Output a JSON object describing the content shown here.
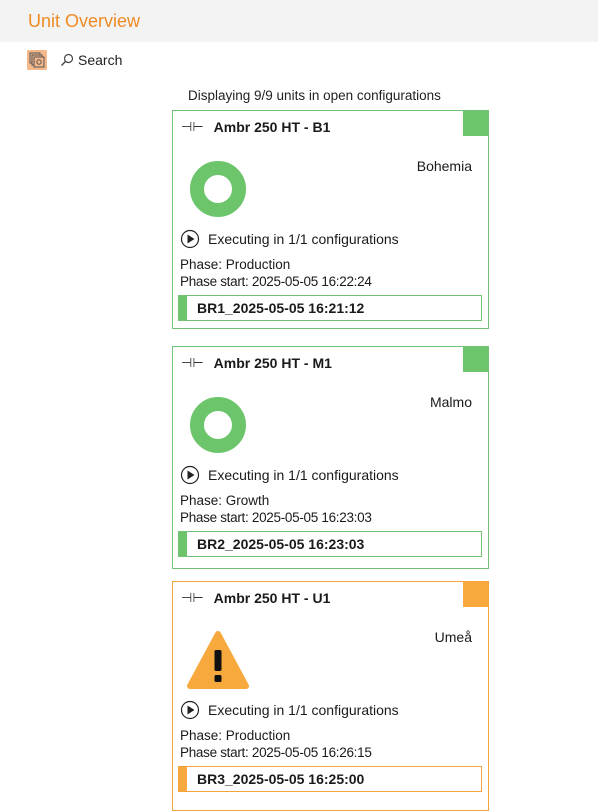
{
  "header": {
    "title": "Unit Overview"
  },
  "toolbar": {
    "search_label": "Search"
  },
  "summary": {
    "text": "Displaying 9/9 units in open configurations"
  },
  "colors": {
    "accent": "#f08a24",
    "ok": "#6cc56b",
    "warning": "#f7a93d"
  },
  "units": [
    {
      "name": "Ambr 250 HT - B1",
      "location": "Bohemia",
      "status": "ok",
      "status_icon": "ring-icon",
      "execution": "Executing in 1/1 configurations",
      "phase": "Phase: Production",
      "phase_start": "Phase start: 2025-05-05 16:22:24",
      "run": "BR1_2025-05-05 16:21:12"
    },
    {
      "name": "Ambr 250 HT - M1",
      "location": "Malmo",
      "status": "ok",
      "status_icon": "ring-icon",
      "execution": "Executing in 1/1 configurations",
      "phase": "Phase: Growth",
      "phase_start": "Phase start: 2025-05-05 16:23:03",
      "run": "BR2_2025-05-05 16:23:03"
    },
    {
      "name": "Ambr 250 HT - U1",
      "location": "Umeå",
      "status": "warning",
      "status_icon": "warning-icon",
      "execution": "Executing in 1/1 configurations",
      "phase": "Phase: Production",
      "phase_start": "Phase start: 2025-05-05 16:26:15",
      "run": "BR3_2025-05-05 16:25:00"
    }
  ]
}
